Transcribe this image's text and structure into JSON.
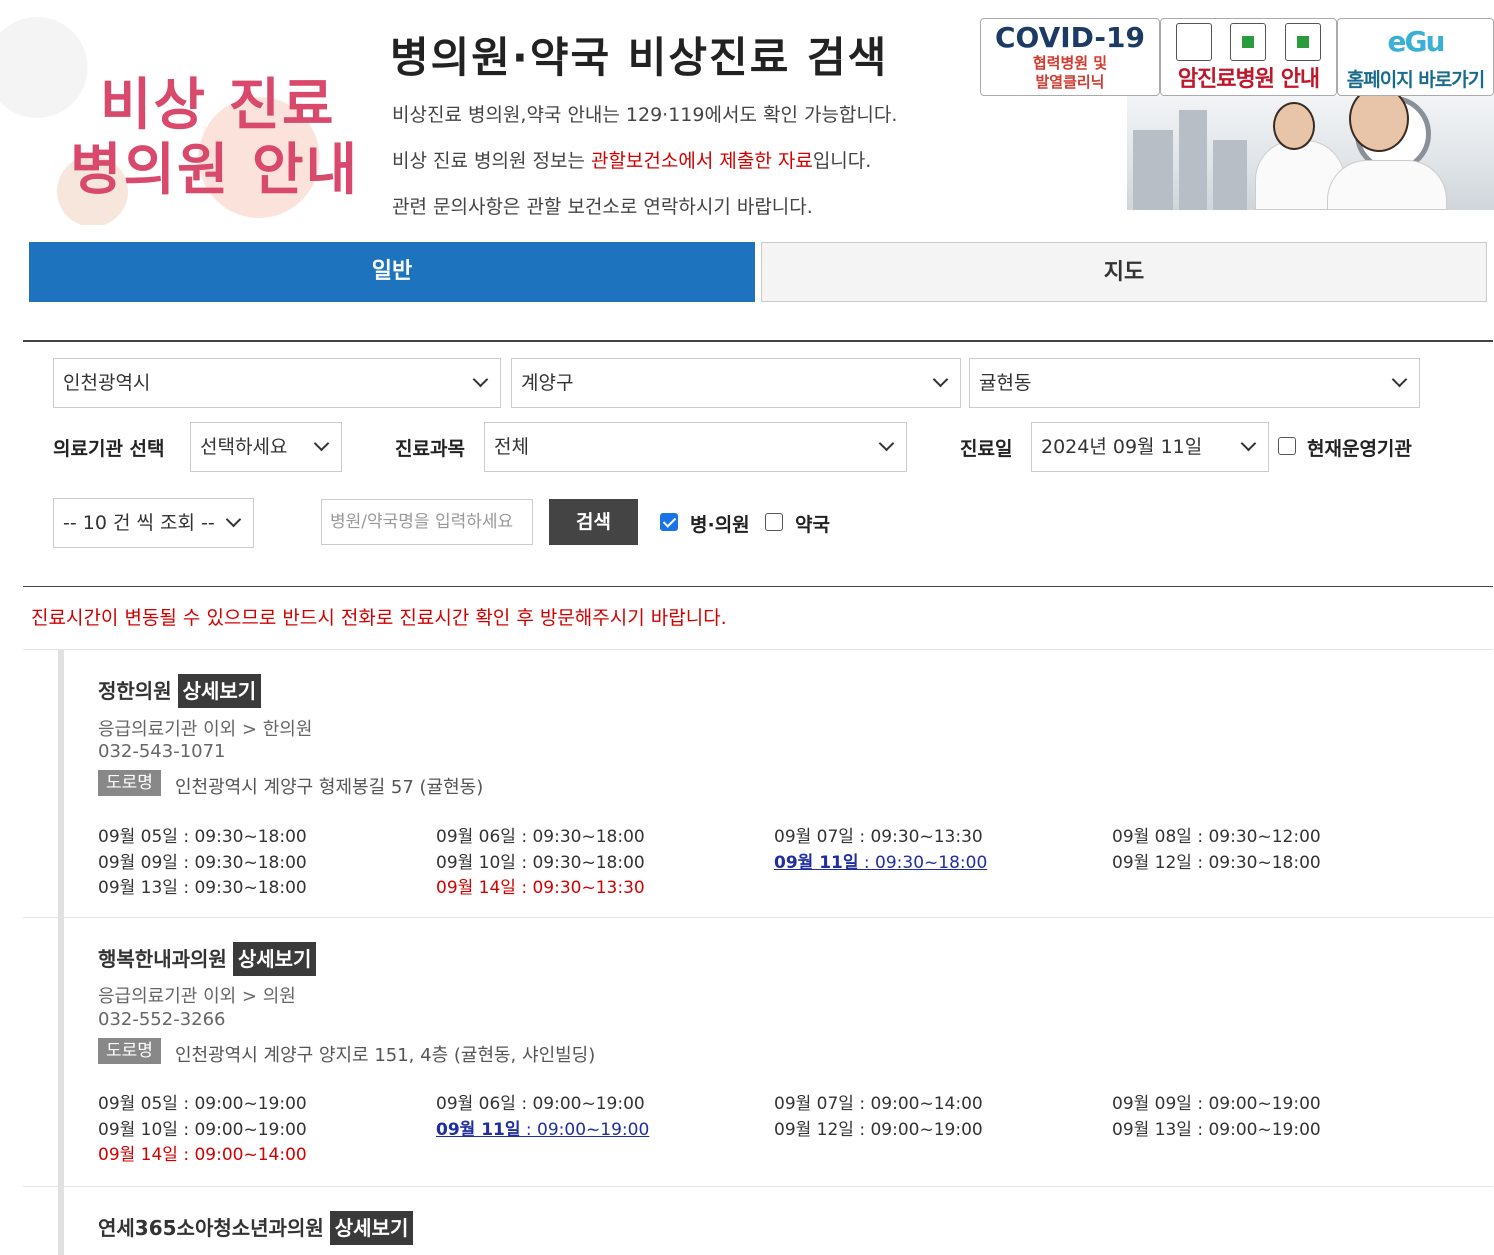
{
  "brand": {
    "line1": "비상 진료",
    "line2": "병의원 안내"
  },
  "header": {
    "title": "병의원·약국 비상진료 검색",
    "intro1": "비상진료 병의원,약국 안내는 129·119에서도 확인 가능합니다.",
    "intro2_a": "비상 진료 병의원 정보는 ",
    "intro2_red": "관할보건소에서 제출한 자료",
    "intro2_b": "입니다.",
    "intro3": "관련 문의사항은 관할 보건소로 연락하시기 바랍니다."
  },
  "banners": {
    "covid_title": "COVID-19",
    "covid_sub1": "협력병원 및",
    "covid_sub2": "발열클리닉",
    "cancer": "암진료병원 안내",
    "egu": "홈페이지 바로가기"
  },
  "tabs": {
    "general": "일반",
    "map": "지도"
  },
  "search": {
    "city": "인천광역시",
    "district": "계양구",
    "dong": "귤현동",
    "inst_label": "의료기관 선택",
    "inst_value": "선택하세요",
    "dept_label": "진료과목",
    "dept_value": "전체",
    "date_label": "진료일",
    "date_value": "2024년 09월 11일",
    "now_open_label": "현재운영기관",
    "per_page": "-- 10 건 씩 조회 --",
    "name_placeholder": "병원/약국명을 입력하세요",
    "search_btn": "검색",
    "hospital_label": "병·의원",
    "pharmacy_label": "약국"
  },
  "notice": "진료시간이 변동될 수 있으므로 반드시 전화로 진료시간 확인 후 방문해주시기 바랍니다.",
  "detail_label": "상세보기",
  "addr_label": "도로명",
  "results": [
    {
      "name": "정한의원",
      "category": "응급의료기관 이외 > 한의원",
      "phone": "032-543-1071",
      "address": "인천광역시 계양구 형제봉길 57 (귤현동)",
      "schedule": [
        {
          "day": "09월 05일",
          "time": " : 09:30~18:00",
          "type": "normal"
        },
        {
          "day": "09월 06일",
          "time": " : 09:30~18:00",
          "type": "normal"
        },
        {
          "day": "09월 07일",
          "time": " : 09:30~13:30",
          "type": "normal"
        },
        {
          "day": "09월 08일",
          "time": " : 09:30~12:00",
          "type": "normal"
        },
        {
          "day": "09월 09일",
          "time": " : 09:30~18:00",
          "type": "normal"
        },
        {
          "day": "09월 10일",
          "time": " : 09:30~18:00",
          "type": "normal"
        },
        {
          "day": "09월 11일",
          "time": " : 09:30~18:00",
          "type": "today"
        },
        {
          "day": "09월 12일",
          "time": " : 09:30~18:00",
          "type": "normal"
        },
        {
          "day": "09월 13일",
          "time": " : 09:30~18:00",
          "type": "normal"
        },
        {
          "day": "09월 14일",
          "time": " : 09:30~13:30",
          "type": "holiday"
        }
      ]
    },
    {
      "name": "행복한내과의원",
      "category": "응급의료기관 이외 > 의원",
      "phone": "032-552-3266",
      "address": "인천광역시 계양구 양지로 151, 4층 (귤현동, 샤인빌딩)",
      "schedule": [
        {
          "day": "09월 05일",
          "time": " : 09:00~19:00",
          "type": "normal"
        },
        {
          "day": "09월 06일",
          "time": " : 09:00~19:00",
          "type": "normal"
        },
        {
          "day": "09월 07일",
          "time": " : 09:00~14:00",
          "type": "normal"
        },
        {
          "day": "09월 09일",
          "time": " : 09:00~19:00",
          "type": "normal"
        },
        {
          "day": "09월 10일",
          "time": " : 09:00~19:00",
          "type": "normal"
        },
        {
          "day": "09월 11일",
          "time": " : 09:00~19:00",
          "type": "today"
        },
        {
          "day": "09월 12일",
          "time": " : 09:00~19:00",
          "type": "normal"
        },
        {
          "day": "09월 13일",
          "time": " : 09:00~19:00",
          "type": "normal"
        },
        {
          "day": "09월 14일",
          "time": " : 09:00~14:00",
          "type": "holiday"
        }
      ]
    },
    {
      "name": "연세365소아청소년과의원",
      "category": "",
      "phone": "",
      "address": "",
      "schedule": []
    }
  ]
}
